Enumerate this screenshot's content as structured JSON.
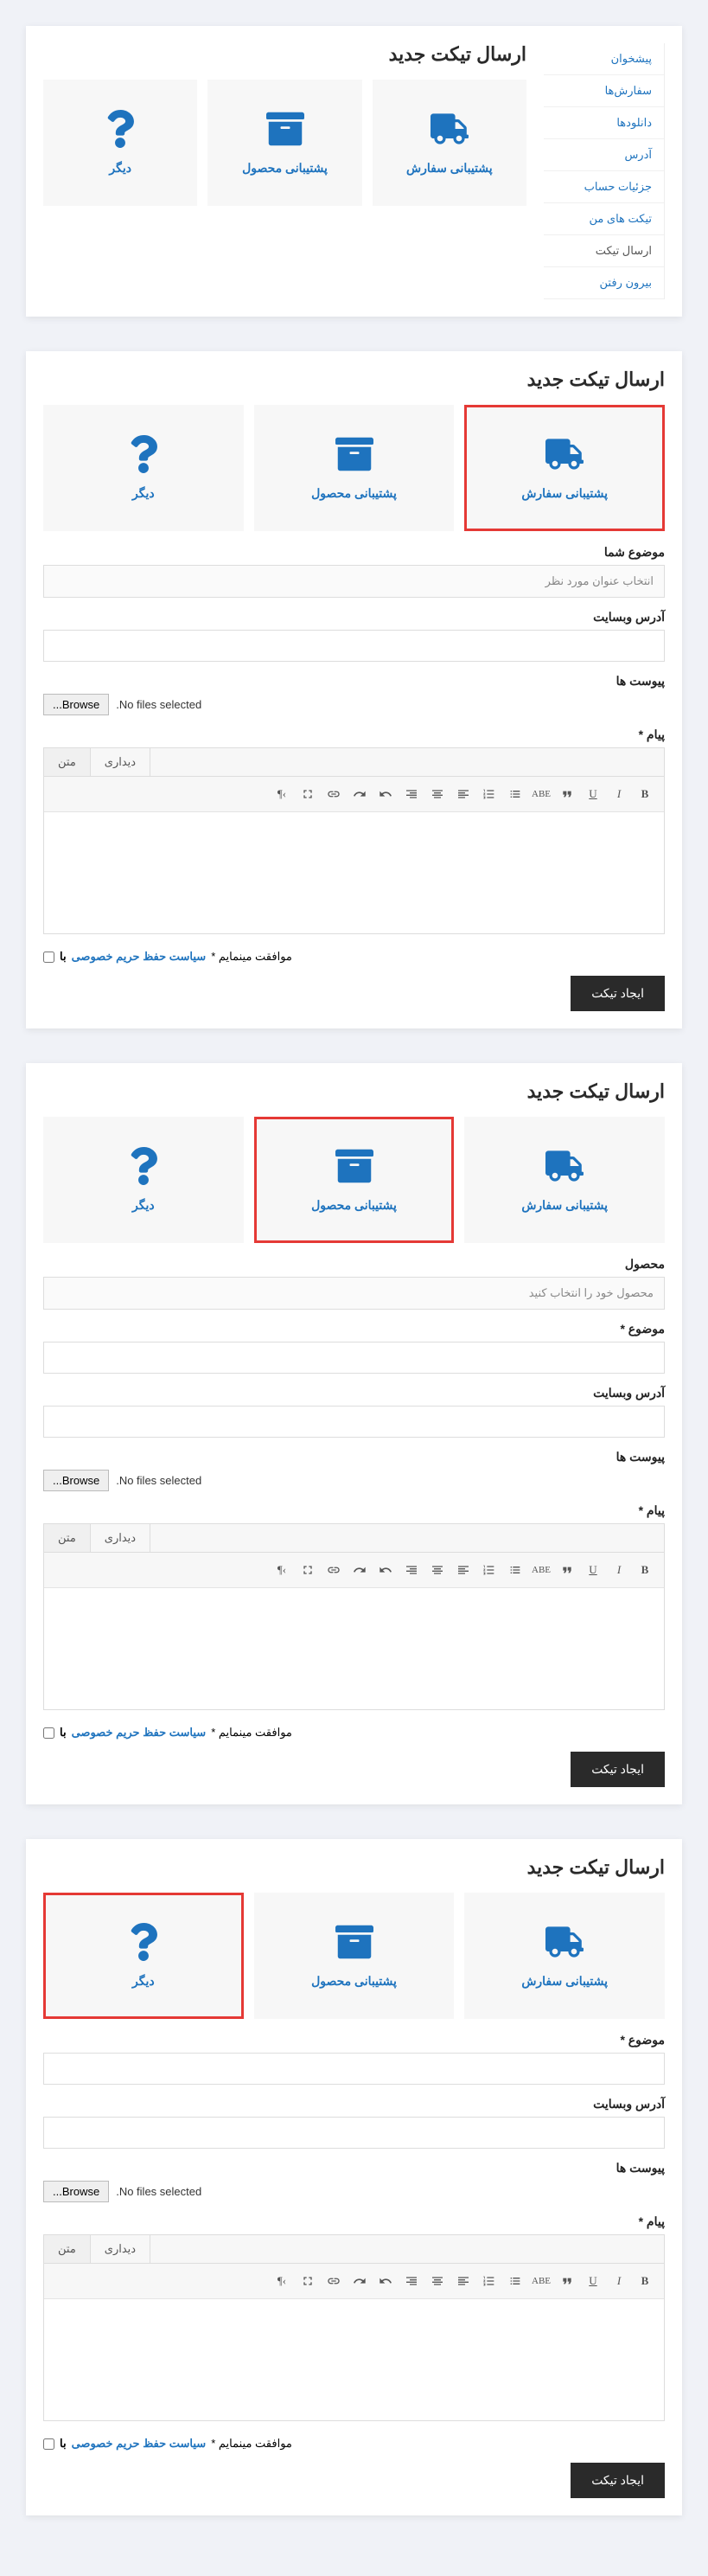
{
  "title": "ارسال تیکت جدید",
  "sidebar": {
    "items": [
      "پیشخوان",
      "سفارش‌ها",
      "دانلودها",
      "آدرس",
      "جزئیات حساب",
      "تیکت های من",
      "ارسال تیکت",
      "بیرون رفتن"
    ],
    "activeIndex": 6
  },
  "categories": [
    {
      "label": "پشتیبانی سفارش",
      "icon": "truck"
    },
    {
      "label": "پشتیبانی محصول",
      "icon": "box"
    },
    {
      "label": "دیگر",
      "icon": "question"
    }
  ],
  "labels": {
    "subject_you": "موضوع شما",
    "subject_placeholder": "انتخاب عنوان مورد نظر",
    "website": "آدرس وبسایت",
    "attachments": "پیوست ها",
    "browse": "Browse...",
    "no_files": "No files selected.",
    "message": "پیام *",
    "product": "محصول",
    "product_placeholder": "محصول خود را انتخاب کنید",
    "subject": "موضوع *",
    "tab_visual": "دیداری",
    "tab_text": "متن",
    "agree_prefix": "با",
    "agree_link": "سیاست حفظ حریم خصوصی",
    "agree_suffix": "موافقت مینمایم *",
    "submit": "ایجاد تیکت"
  },
  "panels": [
    {
      "selected": -1,
      "hasSidebar": true,
      "fields": []
    },
    {
      "selected": 0,
      "fields": [
        "subject_you_select",
        "website",
        "attachments",
        "message"
      ]
    },
    {
      "selected": 1,
      "fields": [
        "product_select",
        "subject",
        "website",
        "attachments",
        "message"
      ]
    },
    {
      "selected": 2,
      "fields": [
        "subject",
        "website",
        "attachments",
        "message"
      ]
    }
  ]
}
